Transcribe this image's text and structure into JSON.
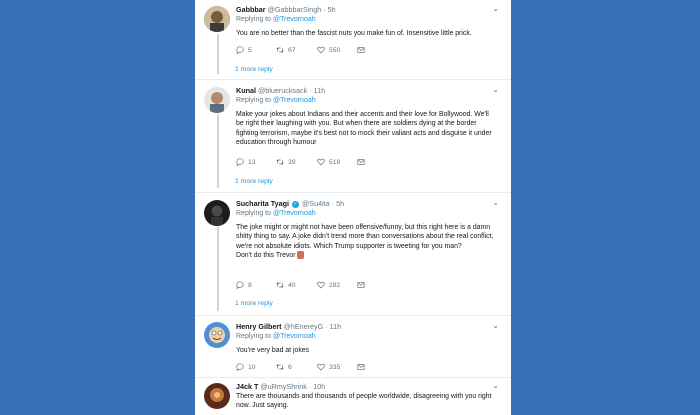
{
  "tweets": [
    {
      "name": "Gabbbar",
      "handle": "@GabbbarSingh",
      "time": "· 5h",
      "replying_label": "Replying to",
      "replying_to": "@Trevornoah",
      "body": [
        "You are no better than the fascist nuts you make fun of. Insensitive little prick."
      ],
      "reply_count": "5",
      "retweet_count": "67",
      "like_count": "550",
      "more_replies": "1 more reply"
    },
    {
      "name": "Kunal",
      "handle": "@bluerucksack",
      "time": "· 11h",
      "replying_label": "Replying to",
      "replying_to": "@Trevornoah",
      "body": [
        "Make your jokes about Indians and their accents and their love for Bollywood. We'll be right their laughing with you. But when there are soldiers dying at the border fighting terrorism, maybe it's best not to mock their valiant acts and disguise it under education through humour"
      ],
      "reply_count": "13",
      "retweet_count": "39",
      "like_count": "518",
      "more_replies": "1 more reply"
    },
    {
      "name": "Sucharita Tyagi",
      "handle": "@Su4ita",
      "time": "· 5h",
      "replying_label": "Replying to",
      "replying_to": "@Trevornoah",
      "body": [
        "The joke might or might not have been offensive/funny, but this right here is a damn shitty thing to say. A joke didn't trend more than conversations about the real conflict,  we're not absolute idiots. Which Trump supporter is tweeting for you man?",
        "Don't do this Trevor"
      ],
      "reply_count": "8",
      "retweet_count": "40",
      "like_count": "282",
      "more_replies": "1 more reply"
    },
    {
      "name": "Henry Gilbert",
      "handle": "@hEnereyG",
      "time": "· 11h",
      "replying_label": "Replying to",
      "replying_to": "@Trevornoah",
      "body": [
        "You're very bad at jokes"
      ],
      "reply_count": "10",
      "retweet_count": "6",
      "like_count": "335"
    },
    {
      "name": "J4ck T",
      "handle": "@uRmyShrink",
      "time": "· 10h",
      "body": [
        "There are thousands and thousands of people worldwide, disagreeing with you right now. Just saying."
      ]
    }
  ]
}
